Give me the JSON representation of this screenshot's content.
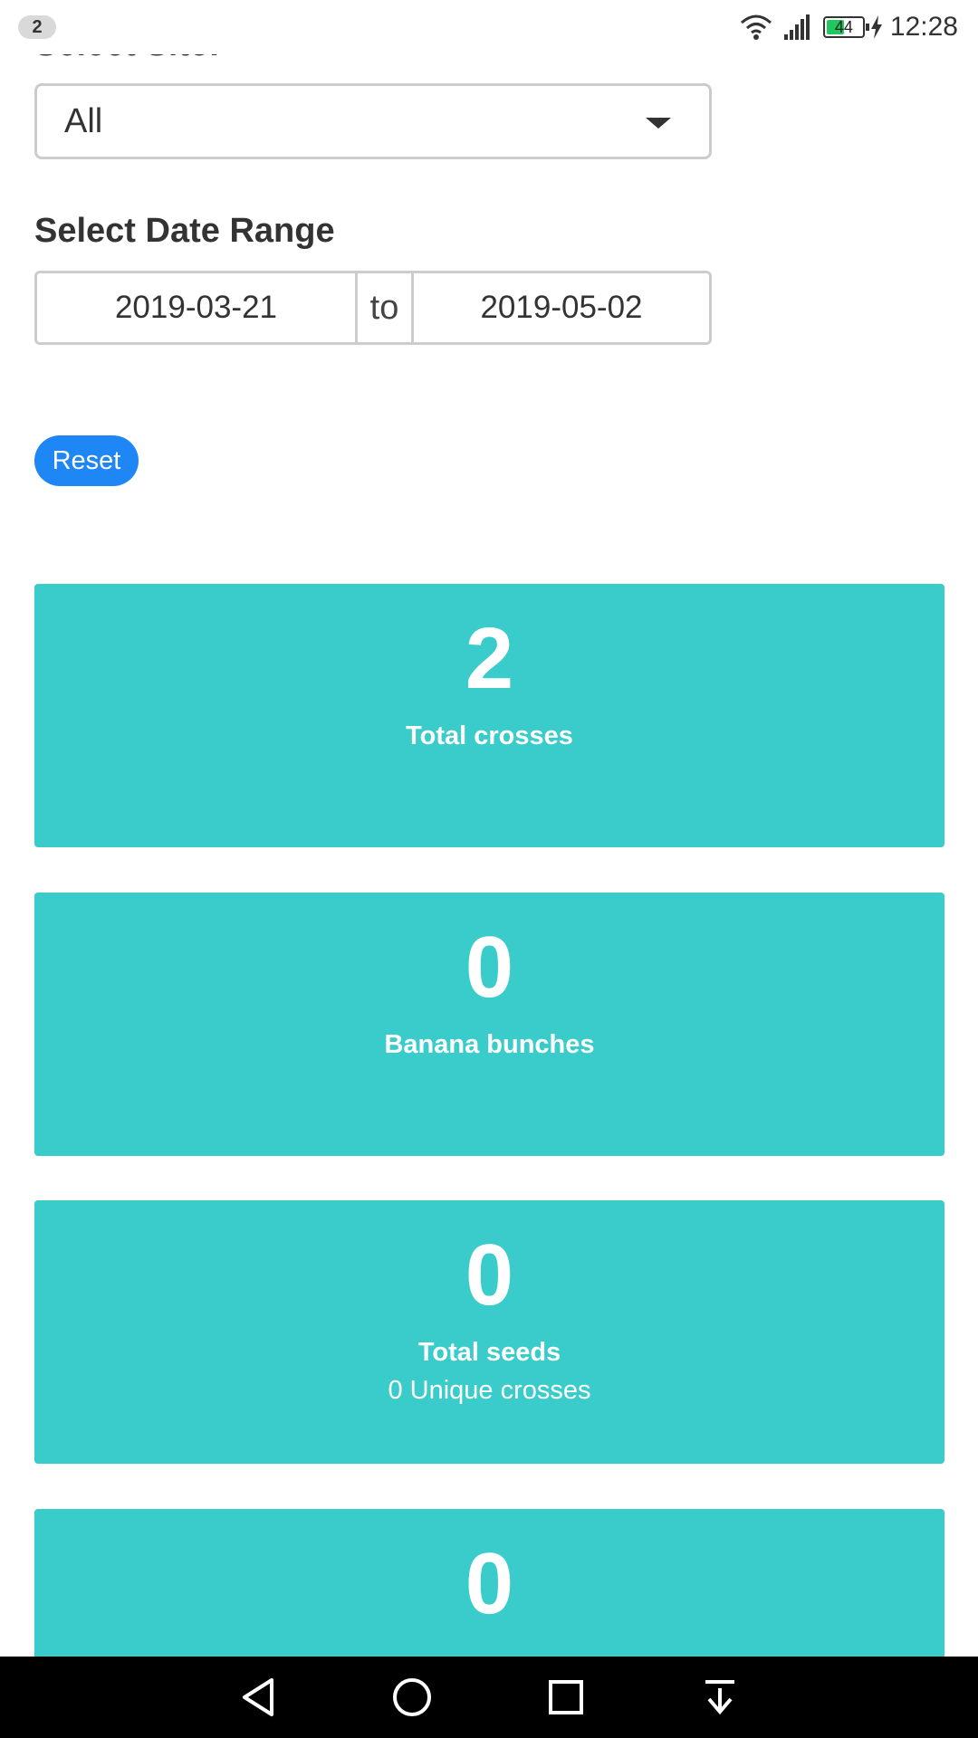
{
  "status_bar": {
    "notification_count": "2",
    "battery_level": "44",
    "time": "12:28",
    "icons": [
      "wifi-icon",
      "signal-icon",
      "battery-icon",
      "charging-icon"
    ]
  },
  "filters": {
    "site_label": "Select Site:",
    "site_value": "All",
    "date_label": "Select Date Range",
    "date_start": "2019-03-21",
    "date_separator": "to",
    "date_end": "2019-05-02",
    "reset_label": "Reset"
  },
  "cards": [
    {
      "value": "2",
      "title": "Total crosses",
      "subtitle": ""
    },
    {
      "value": "0",
      "title": "Banana bunches",
      "subtitle": ""
    },
    {
      "value": "0",
      "title": "Total seeds",
      "subtitle": "0 Unique crosses"
    },
    {
      "value": "0",
      "title": "",
      "subtitle": ""
    }
  ],
  "nav": {
    "icons": [
      "back-icon",
      "home-icon",
      "recents-icon",
      "notification-shade-icon"
    ]
  },
  "colors": {
    "card": "#3acbcb",
    "button": "#1e86f5",
    "battery": "#22c55e"
  }
}
